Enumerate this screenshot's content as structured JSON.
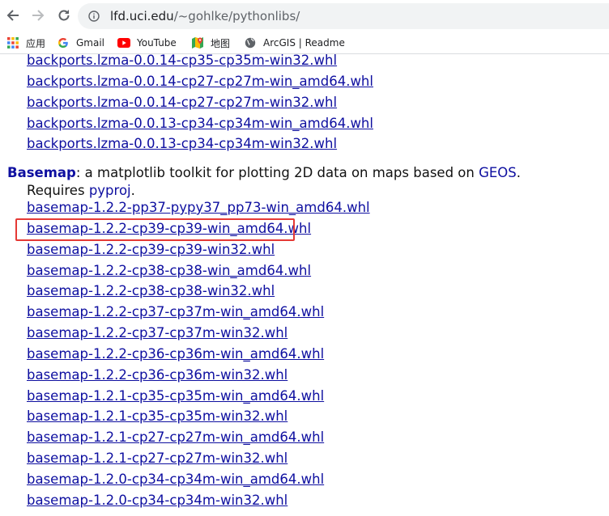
{
  "browser": {
    "url_host": "lfd.uci.edu",
    "url_path": "/~gohlke/pythonlibs/"
  },
  "bookmarks": [
    {
      "label": "应用",
      "icon": "apps-grid-icon"
    },
    {
      "label": "Gmail",
      "icon": "google-g-icon"
    },
    {
      "label": "YouTube",
      "icon": "youtube-icon"
    },
    {
      "label": "地图",
      "icon": "maps-pin-icon"
    },
    {
      "label": "ArcGIS | Readme",
      "icon": "globe-icon"
    }
  ],
  "backports_links": [
    "backports.lzma-0.0.14-cp35-cp35m-win32.whl",
    "backports.lzma-0.0.14-cp27-cp27m-win_amd64.whl",
    "backports.lzma-0.0.14-cp27-cp27m-win32.whl",
    "backports.lzma-0.0.13-cp34-cp34m-win_amd64.whl",
    "backports.lzma-0.0.13-cp34-cp34m-win32.whl"
  ],
  "basemap": {
    "name": "Basemap",
    "description": ": a matplotlib toolkit for plotting 2D data on maps based on ",
    "geos_link": "GEOS",
    "period": ".",
    "requires_text": "Requires ",
    "pyproj_link": "pyproj",
    "links": [
      "basemap-1.2.2-pp37-pypy37_pp73-win_amd64.whl",
      "basemap-1.2.2-cp39-cp39-win_amd64.whl",
      "basemap-1.2.2-cp39-cp39-win32.whl",
      "basemap-1.2.2-cp38-cp38-win_amd64.whl",
      "basemap-1.2.2-cp38-cp38-win32.whl",
      "basemap-1.2.2-cp37-cp37m-win_amd64.whl",
      "basemap-1.2.2-cp37-cp37m-win32.whl",
      "basemap-1.2.2-cp36-cp36m-win_amd64.whl",
      "basemap-1.2.2-cp36-cp36m-win32.whl",
      "basemap-1.2.1-cp35-cp35m-win_amd64.whl",
      "basemap-1.2.1-cp35-cp35m-win32.whl",
      "basemap-1.2.1-cp27-cp27m-win_amd64.whl",
      "basemap-1.2.1-cp27-cp27m-win32.whl",
      "basemap-1.2.0-cp34-cp34m-win_amd64.whl",
      "basemap-1.2.0-cp34-cp34m-win32.whl"
    ]
  },
  "colors": {
    "link": "#0e0fa0",
    "highlight": "#e53935"
  }
}
